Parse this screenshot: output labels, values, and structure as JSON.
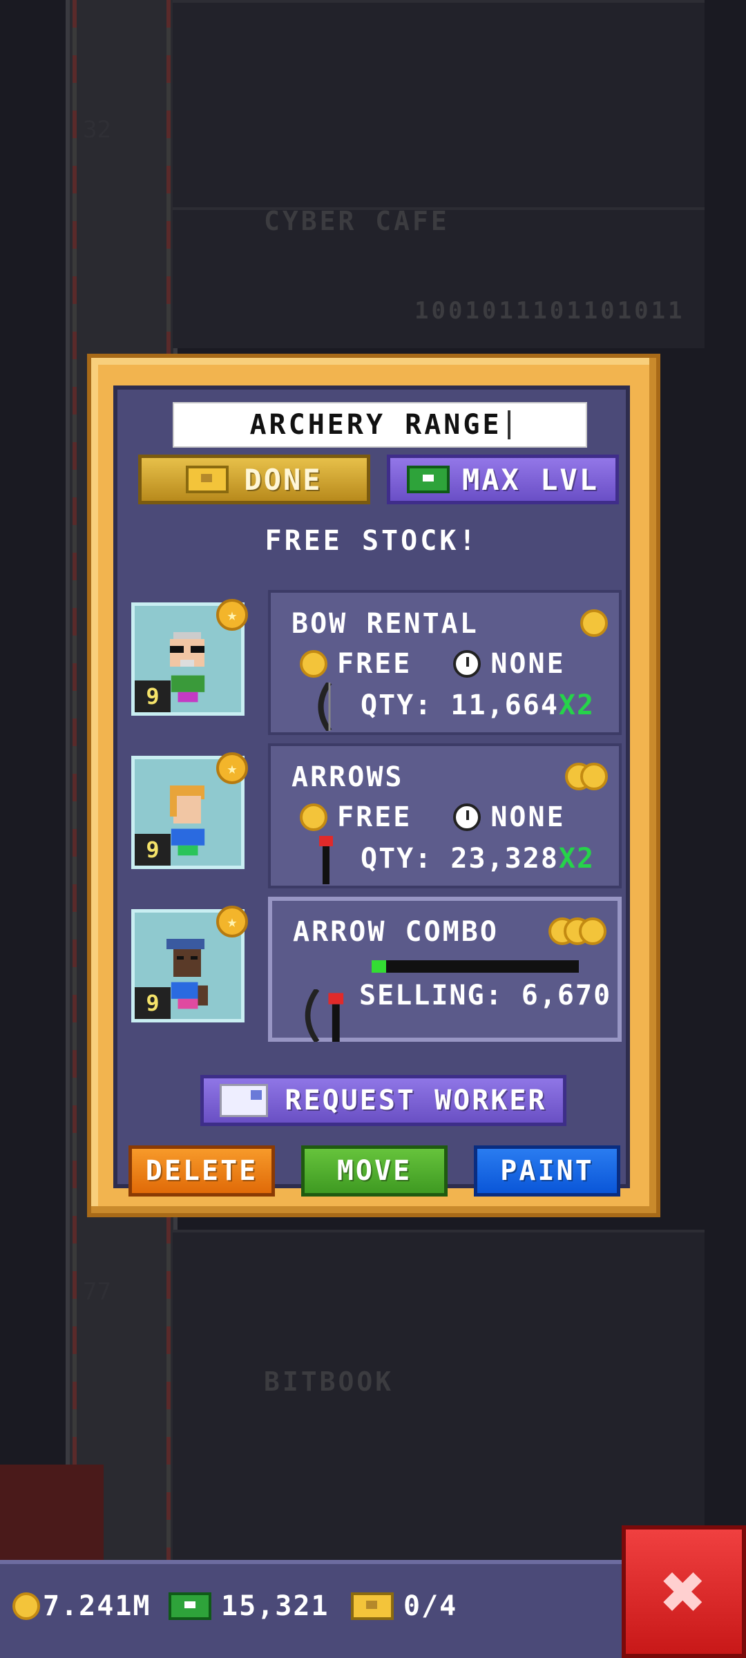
{
  "background": {
    "floor_names": [
      "CYBER CAFE",
      "BITBOOK"
    ],
    "floor_numbers": [
      "32",
      "77"
    ],
    "binary_text": "1001011101101011"
  },
  "dialog": {
    "name_field_value": "ARCHERY RANGE",
    "done_label": "DONE",
    "max_level_label": "MAX LVL",
    "free_stock_label": "FREE STOCK!",
    "products": [
      {
        "name": "BOW RENTAL",
        "coin_tier": 1,
        "price": "FREE",
        "time": "NONE",
        "qty_label": "QTY:",
        "qty": "11,664",
        "multiplier": "X2",
        "worker_level": "9"
      },
      {
        "name": "ARROWS",
        "coin_tier": 2,
        "price": "FREE",
        "time": "NONE",
        "qty_label": "QTY:",
        "qty": "23,328",
        "multiplier": "X2",
        "worker_level": "9"
      },
      {
        "name": "ARROW COMBO",
        "coin_tier": 3,
        "selling_label": "SELLING:",
        "selling_value": "6,670",
        "progress": 0.07,
        "worker_level": "9"
      }
    ],
    "request_worker_label": "REQUEST WORKER",
    "delete_label": "DELETE",
    "move_label": "MOVE",
    "paint_label": "PAINT"
  },
  "status_bar": {
    "coins": "7.241M",
    "bux": "15,321",
    "tickets": "0/4"
  },
  "colors": {
    "dialog_frame": "#f2b44f",
    "dialog_body": "#4b4a78",
    "multiplier": "#26d34a",
    "close": "#d42020"
  },
  "icons": {
    "close": "close-x-icon",
    "coin": "coin-icon",
    "bux": "bux-bill-icon",
    "ticket": "golden-ticket-icon",
    "clock": "clock-icon",
    "mail": "mail-icon"
  }
}
